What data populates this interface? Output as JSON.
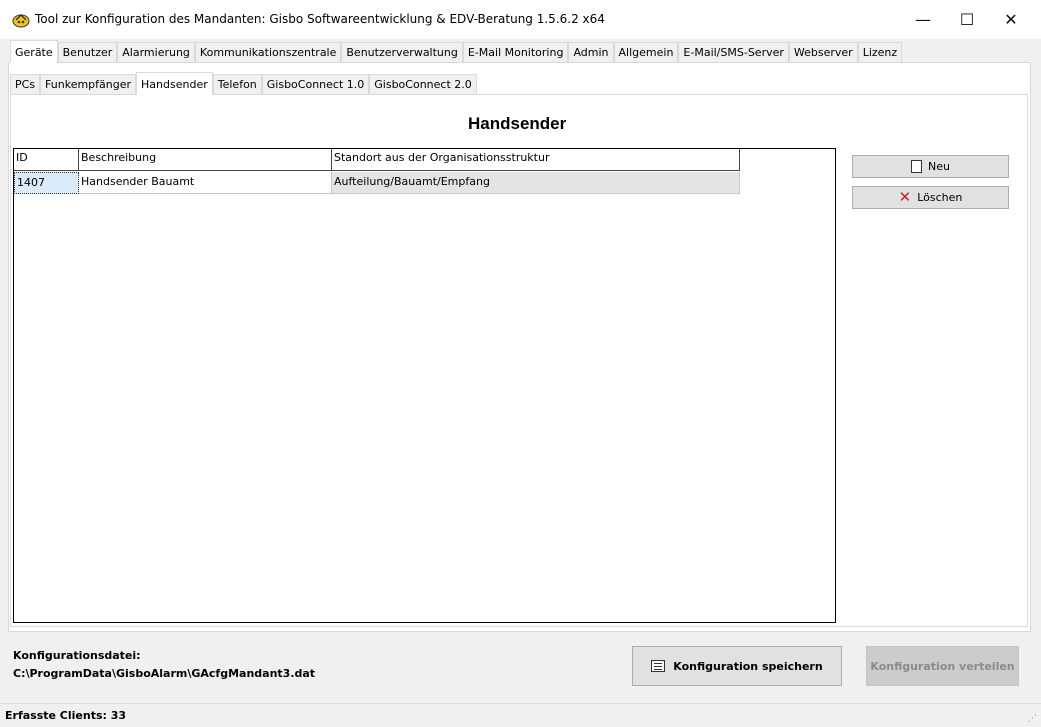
{
  "window": {
    "title": "Tool zur Konfiguration des Mandanten: Gisbo Softwareentwicklung & EDV-Beratung 1.5.6.2 x64",
    "minimize_glyph": "—",
    "maximize_glyph": "☐",
    "close_glyph": "✕"
  },
  "outer_tabs": [
    "Geräte",
    "Benutzer",
    "Alarmierung",
    "Kommunikationszentrale",
    "Benutzerverwaltung",
    "E-Mail Monitoring",
    "Admin",
    "Allgemein",
    "E-Mail/SMS-Server",
    "Webserver",
    "Lizenz"
  ],
  "outer_active": "Geräte",
  "inner_tabs": [
    "PCs",
    "Funkempfänger",
    "Handsender",
    "Telefon",
    "GisboConnect 1.0",
    "GisboConnect 2.0"
  ],
  "inner_active": "Handsender",
  "section_title": "Handsender",
  "grid": {
    "columns": [
      "ID",
      "Beschreibung",
      "Standort aus der Organisationsstruktur"
    ],
    "rows": [
      [
        "1407",
        "Handsender Bauamt",
        "Aufteilung/Bauamt/Empfang"
      ]
    ]
  },
  "buttons": {
    "new": "Neu",
    "delete": "Löschen",
    "save": "Konfiguration speichern",
    "distribute": "Konfiguration verteilen"
  },
  "footer": {
    "config_label": "Konfigurationsdatei:",
    "config_path": "C:\\ProgramData\\GisboAlarm\\GAcfgMandant3.dat"
  },
  "status": {
    "clients": "Erfasste Clients: 33"
  },
  "colors": {
    "delete_icon": "#c0282b",
    "selected_cell": "#d9ebf9",
    "disabled_button": "#cccccc"
  }
}
